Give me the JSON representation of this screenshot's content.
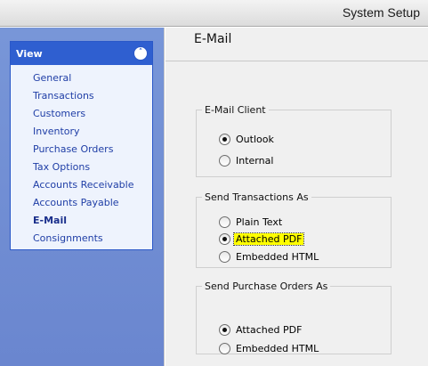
{
  "window": {
    "title": "System Setup"
  },
  "sidebar": {
    "header": "View",
    "collapse_icon": "double-chevron-up-icon",
    "items": [
      {
        "label": "General"
      },
      {
        "label": "Transactions"
      },
      {
        "label": "Customers"
      },
      {
        "label": "Inventory"
      },
      {
        "label": "Purchase Orders"
      },
      {
        "label": "Tax Options"
      },
      {
        "label": "Accounts Receivable"
      },
      {
        "label": "Accounts Payable"
      },
      {
        "label": "E-Mail",
        "active": true
      },
      {
        "label": "Consignments"
      }
    ]
  },
  "main": {
    "title": "E-Mail",
    "email_client": {
      "legend": "E-Mail Client",
      "options": [
        {
          "label": "Outlook",
          "selected": true
        },
        {
          "label": "Internal",
          "selected": false
        }
      ]
    },
    "send_transactions": {
      "legend": "Send Transactions As",
      "options": [
        {
          "label": "Plain Text",
          "selected": false
        },
        {
          "label": "Attached PDF",
          "selected": true,
          "highlighted": true
        },
        {
          "label": "Embedded HTML",
          "selected": false
        }
      ]
    },
    "send_purchase_orders": {
      "legend": "Send Purchase Orders As",
      "options": [
        {
          "label": "Attached PDF",
          "selected": true
        },
        {
          "label": "Embedded HTML",
          "selected": false
        }
      ]
    }
  },
  "colors": {
    "sidebar_bg": "#7896d8",
    "nav_header": "#2f5fd0",
    "nav_link": "#1f3ea6",
    "highlight": "#ffff00"
  }
}
